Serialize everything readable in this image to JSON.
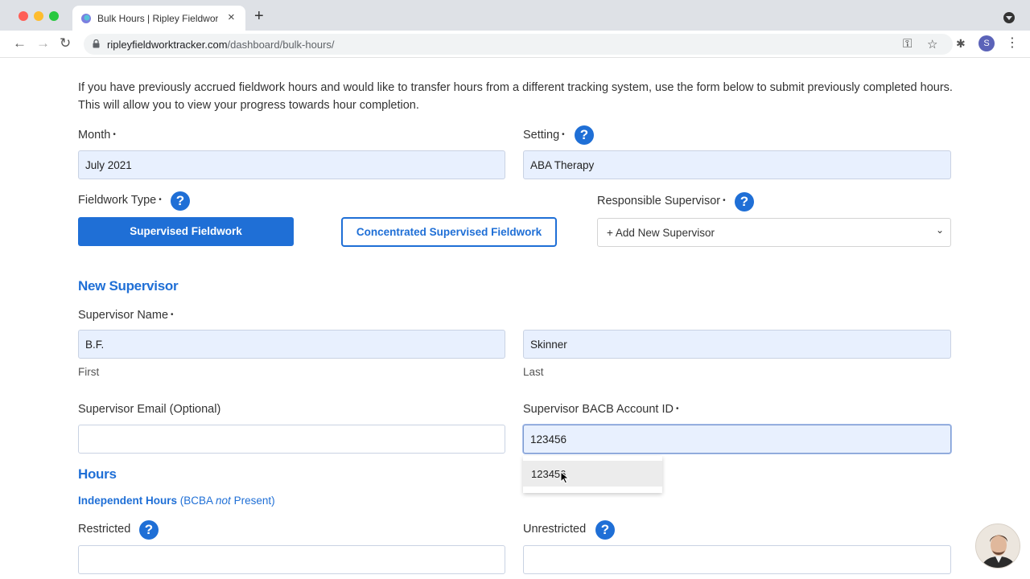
{
  "browser": {
    "tab_title": "Bulk Hours | Ripley Fieldwork T",
    "url_domain": "ripleyfieldworktracker.com",
    "url_path": "/dashboard/bulk-hours/",
    "profile_initial": "S"
  },
  "intro_text": "If you have previously accrued fieldwork hours and would like to transfer hours from a different tracking system, use the form below to submit previously completed hours. This will allow you to view your progress towards hour completion.",
  "form": {
    "month": {
      "label": "Month",
      "value": "July 2021"
    },
    "setting": {
      "label": "Setting",
      "value": "ABA Therapy"
    },
    "fieldwork_type": {
      "label": "Fieldwork Type",
      "options": [
        "Supervised Fieldwork",
        "Concentrated Supervised Fieldwork"
      ],
      "selected": "Supervised Fieldwork"
    },
    "responsible_supervisor": {
      "label": "Responsible Supervisor",
      "value": "+ Add New Supervisor"
    },
    "required_mark": "•",
    "help_glyph": "?"
  },
  "new_supervisor": {
    "heading": "New Supervisor",
    "name_label": "Supervisor Name",
    "first_value": "B.F.",
    "first_sub": "First",
    "last_value": "Skinner",
    "last_sub": "Last",
    "email_label": "Supervisor Email (Optional)",
    "email_value": "",
    "bacb_label": "Supervisor BACB Account ID",
    "bacb_value": "123456",
    "autocomplete_suggestion": "123456"
  },
  "hours": {
    "heading": "Hours",
    "independent_bold": "Independent Hours",
    "independent_pre": " (BCBA ",
    "independent_em": "not",
    "independent_post": " Present)",
    "restricted_label": "Restricted",
    "unrestricted_label": "Unrestricted"
  },
  "colors": {
    "accent": "#1f6fd6",
    "input_fill": "#e8f0fe"
  }
}
